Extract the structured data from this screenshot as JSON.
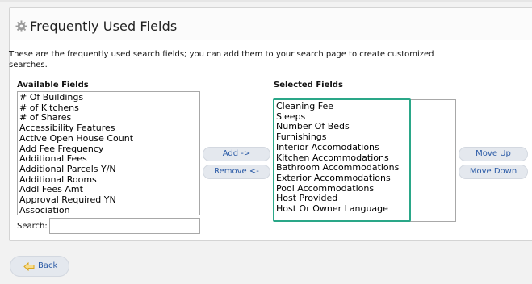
{
  "panel": {
    "title": "Frequently Used Fields",
    "icon": "gear-icon",
    "description": "These are the frequently used search fields; you can add them to your search page to create customized searches."
  },
  "available": {
    "label": "Available Fields",
    "items": [
      "# Of Buildings",
      "# of Kitchens",
      "# of Shares",
      "Accessibility Features",
      "Active Open House Count",
      "Add Fee Frequency",
      "Additional Fees",
      "Additional Parcels Y/N",
      "Additional Rooms",
      "Addl Fees Amt",
      "Approval Required YN",
      "Association"
    ]
  },
  "selected": {
    "label": "Selected Fields",
    "items": [
      "Cleaning Fee",
      "Sleeps",
      "Number Of Beds",
      "Furnishings",
      "Interior Accomodations",
      "Kitchen Accommodations",
      "Bathroom Accommodations",
      "Exterior Accommodations",
      "Pool Accommodations",
      "Host Provided",
      "Host Or Owner Language"
    ],
    "highlight_color": "#2aa788"
  },
  "buttons": {
    "add": "Add ->",
    "remove": "Remove <-",
    "move_up": "Move Up",
    "move_down": "Move Down",
    "back": "Back"
  },
  "search": {
    "label": "Search:",
    "value": "",
    "placeholder": ""
  }
}
